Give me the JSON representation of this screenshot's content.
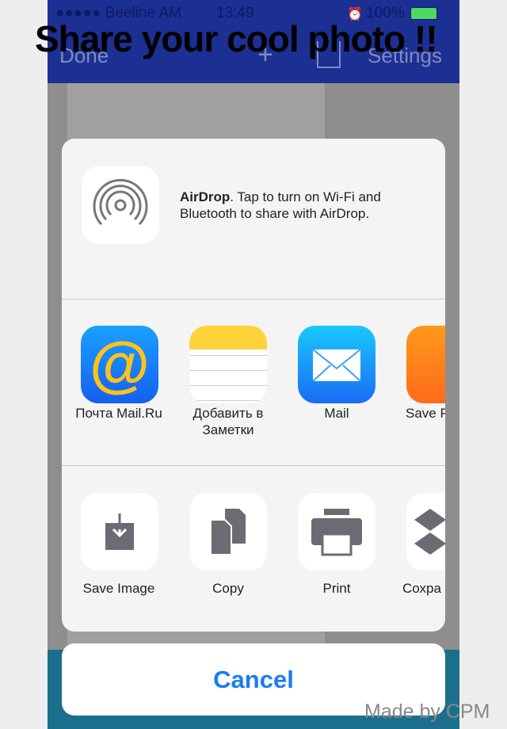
{
  "status_bar": {
    "carrier": "●●●●● Beeline AM",
    "time": "13:49",
    "battery": "100%"
  },
  "nav": {
    "done": "Done",
    "settings": "Settings"
  },
  "overlay_title": "Share your cool photo !!",
  "airdrop": {
    "title": "AirDrop",
    "text": ". Tap to turn on Wi-Fi and Bluetooth to share with AirDrop."
  },
  "apps": [
    {
      "label": "Почта Mail.Ru"
    },
    {
      "label": "Добавить в Заметки"
    },
    {
      "label": "Mail"
    },
    {
      "label": "Save P iBo"
    }
  ],
  "actions": [
    {
      "label": "Save Image"
    },
    {
      "label": "Copy"
    },
    {
      "label": "Print"
    },
    {
      "label": "Сохра Drop"
    }
  ],
  "cancel": "Cancel",
  "footer": "Made by CPM",
  "colors": {
    "nav": "#1c2f93",
    "accent": "#1a7cf5",
    "battery": "#4cd964"
  }
}
